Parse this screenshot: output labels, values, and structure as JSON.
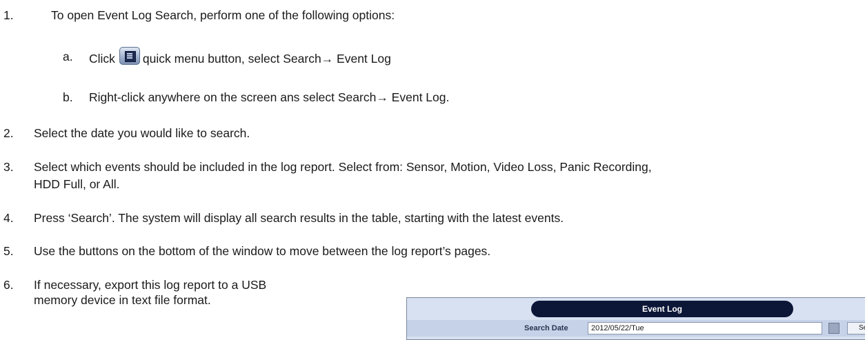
{
  "steps": [
    {
      "num": "1.",
      "text": "To open Event Log Search, perform one of the following options:"
    },
    {
      "num": "2.",
      "text": "Select the date you would like to search."
    },
    {
      "num": "3.",
      "line1": "Select which events should be included in the log report. Select from: Sensor, Motion, Video Loss, Panic Recording,",
      "line2": "HDD Full, or All."
    },
    {
      "num": "4.",
      "text": "Press ‘Search’. The system will display all search results in the table, starting with the latest events."
    },
    {
      "num": "5.",
      "text": "Use the buttons on the bottom of the window to move between the log report’s pages."
    },
    {
      "num": "6.",
      "line1": "If necessary, export this log report to a USB",
      "line2": "memory device in text file format."
    }
  ],
  "substeps": [
    {
      "num": "a.",
      "before": "Click",
      "after": "quick menu button, select Search→ Event Log"
    },
    {
      "num": "b.",
      "text": "Right-click anywhere on the screen ans select Search→ Event Log."
    }
  ],
  "icons": {
    "quick_menu": "quick-menu-icon"
  },
  "event_log": {
    "title": "Event Log",
    "search_date_label": "Search Date",
    "search_date_value": "2012/05/22/Tue",
    "search_button": "Sea"
  }
}
